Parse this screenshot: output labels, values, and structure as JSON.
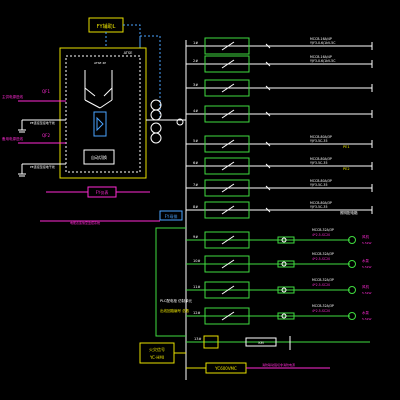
{
  "diagram": {
    "top_box": "FY辅助L",
    "ats_small": "ATSE",
    "ats_label": "自动切换",
    "source1_label": "主供电源进线",
    "source2_label": "备用电源进线",
    "breaker_labels": [
      "QF1",
      "QF2"
    ],
    "neutral_labels": [
      "PE连接至接地干线",
      "PE连接至接地干线"
    ],
    "meter_box": "FY仪表",
    "meter_note": "电能表遥信至监控系统",
    "bus_box": "FY母排",
    "panel_note_1": "PLC配电柜 仿制单元",
    "panel_note_2": "出线回路编号 总数",
    "lower_box_1": "火灾信号",
    "lower_box_2": "YC-HMI",
    "bottom_box": "YC600VMC",
    "bottom_note": "消防联动强切非消防电源",
    "feeders": [
      {
        "tag": "1#",
        "line1": "MCCB-16A/4P",
        "line2": "YJY3-0.6/1kV-5C"
      },
      {
        "tag": "2#",
        "line1": "MCCB-16A/4P",
        "line2": "YJY3-0.6/1kV-5C"
      },
      {
        "tag": "3#",
        "line1": "",
        "line2": ""
      },
      {
        "tag": "4#",
        "line1": "",
        "line2": ""
      },
      {
        "tag": "5#",
        "line1": "MCCB-80A/3P",
        "line2": "YJY3-5C-35"
      },
      {
        "tag": "6#",
        "line1": "MCCB-80A/3P",
        "line2": "YJY3-5C-35"
      },
      {
        "tag": "7#",
        "line1": "MCCB-80A/3P",
        "line2": "YJY3-5C-35"
      },
      {
        "tag": "8#",
        "line1": "MCCB-80A/3P",
        "line2": "YJY3-5C-35"
      }
    ],
    "right_notes": [
      "PE1",
      "PE2",
      "照明配电箱"
    ],
    "motor_feeders": [
      {
        "tag": "9#",
        "line1": "MCCB-32A/3P",
        "line2": "4*2.5-SC20",
        "load": "风机"
      },
      {
        "tag": "10#",
        "line1": "MCCB-32A/3P",
        "line2": "4*2.5-SC20",
        "load": "水泵"
      },
      {
        "tag": "11#",
        "line1": "MCCB-32A/3P",
        "line2": "4*2.5-SC20",
        "load": "风机"
      },
      {
        "tag": "12#",
        "line1": "MCCB-32A/3P",
        "line2": "4*2.5-SC20",
        "load": "水泵"
      }
    ],
    "motor_kw": "5.5kW",
    "contactor_label": "KM",
    "last_tag": "13#"
  }
}
